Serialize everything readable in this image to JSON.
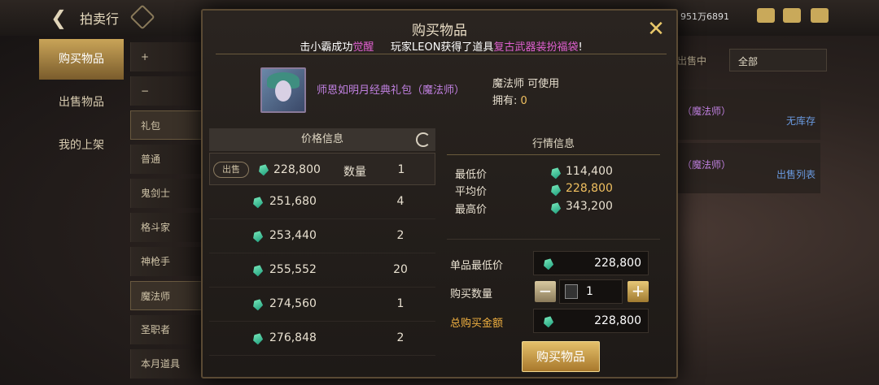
{
  "topbar": {
    "title": "拍卖行",
    "account": "951万6891"
  },
  "nav": {
    "items": [
      "购买物品",
      "出售物品",
      "我的上架"
    ]
  },
  "categories": [
    "+",
    "−",
    "礼包",
    "普通",
    "鬼剑士",
    "格斗家",
    "神枪手",
    "魔法师",
    "圣职者",
    "本月道具"
  ],
  "background_right": {
    "filter_label": "出售中",
    "filter_value": "全部",
    "row1": "（魔法师）",
    "row1_status": "无库存",
    "row2": "（魔法师）",
    "row2_status": "出售列表"
  },
  "modal": {
    "title": "购买物品",
    "ticker": {
      "p1": "击小霸成功",
      "p2": "觉醒",
      "p3": "玩家LEON获得了道具",
      "p4": "复古武器装扮福袋",
      "p5": "!"
    },
    "item": {
      "name": "师恩如明月经典礼包（魔法师）",
      "usable": "魔法师 可使用",
      "own_label": "拥有:",
      "own_value": "0"
    },
    "price_panel": {
      "header": "价格信息",
      "first_row": {
        "badge": "出售",
        "price": "228,800",
        "qty_label": "数量",
        "qty": "1"
      },
      "rows": [
        {
          "price": "251,680",
          "qty": "4"
        },
        {
          "price": "253,440",
          "qty": "2"
        },
        {
          "price": "255,552",
          "qty": "20"
        },
        {
          "price": "274,560",
          "qty": "1"
        },
        {
          "price": "276,848",
          "qty": "2"
        }
      ]
    },
    "market": {
      "header": "行情信息",
      "min_label": "最低价",
      "min_value": "114,400",
      "avg_label": "平均价",
      "avg_value": "228,800",
      "max_label": "最高价",
      "max_value": "343,200"
    },
    "form": {
      "unit_label": "单品最低价",
      "unit_value": "228,800",
      "qty_label": "购买数量",
      "qty_value": "1",
      "total_label": "总购买金额",
      "total_value": "228,800"
    },
    "buy_button": "购买物品"
  }
}
